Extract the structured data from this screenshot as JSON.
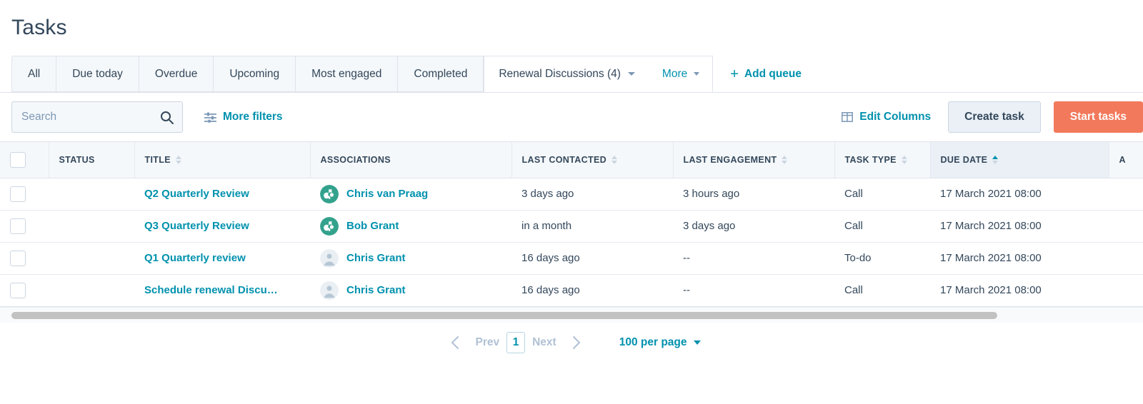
{
  "header": {
    "title": "Tasks"
  },
  "tabs": {
    "items": [
      {
        "label": "All",
        "active": false
      },
      {
        "label": "Due today",
        "active": false
      },
      {
        "label": "Overdue",
        "active": false
      },
      {
        "label": "Upcoming",
        "active": false
      },
      {
        "label": "Most engaged",
        "active": false
      },
      {
        "label": "Completed",
        "active": false
      },
      {
        "label": "Renewal Discussions (4)",
        "active": true
      }
    ],
    "more_label": "More",
    "add_queue_label": "Add queue",
    "add_queue_plus": "+"
  },
  "toolbar": {
    "search_placeholder": "Search",
    "search_value": "",
    "more_filters_label": "More filters",
    "edit_columns_label": "Edit Columns",
    "create_task_label": "Create task",
    "start_tasks_label": "Start tasks",
    "primary_color": "#f2795b",
    "link_color": "#0091ae"
  },
  "table": {
    "columns": [
      {
        "key": "status",
        "label": "STATUS",
        "sortable": false
      },
      {
        "key": "title",
        "label": "TITLE",
        "sortable": true,
        "sort": "none"
      },
      {
        "key": "associations",
        "label": "ASSOCIATIONS",
        "sortable": false
      },
      {
        "key": "last_contacted",
        "label": "LAST CONTACTED",
        "sortable": true,
        "sort": "none"
      },
      {
        "key": "last_engagement",
        "label": "LAST ENGAGEMENT",
        "sortable": true,
        "sort": "none"
      },
      {
        "key": "task_type",
        "label": "TASK TYPE",
        "sortable": true,
        "sort": "none"
      },
      {
        "key": "due_date",
        "label": "DUE DATE",
        "sortable": true,
        "sort": "asc"
      },
      {
        "key": "extra",
        "label": "A",
        "sortable": false
      }
    ],
    "rows": [
      {
        "status": "",
        "title": "Q2 Quarterly Review",
        "association": "Chris van Praag",
        "avatar": "company-logo-icon",
        "last_contacted": "3 days ago",
        "last_engagement": "3 hours ago",
        "task_type": "Call",
        "due_date": "17 March 2021 08:00"
      },
      {
        "status": "",
        "title": "Q3 Quarterly Review",
        "association": "Bob Grant",
        "avatar": "company-logo-icon",
        "last_contacted": "in a month",
        "last_engagement": "3 days ago",
        "task_type": "Call",
        "due_date": "17 March 2021 08:00"
      },
      {
        "status": "",
        "title": "Q1 Quarterly review",
        "association": "Chris Grant",
        "avatar": "person-icon",
        "last_contacted": "16 days ago",
        "last_engagement": "--",
        "task_type": "To-do",
        "due_date": "17 March 2021 08:00"
      },
      {
        "status": "",
        "title": "Schedule renewal Discu…",
        "association": "Chris Grant",
        "avatar": "person-icon",
        "last_contacted": "16 days ago",
        "last_engagement": "--",
        "task_type": "Call",
        "due_date": "17 March 2021 08:00"
      }
    ]
  },
  "pagination": {
    "prev_label": "Prev",
    "current_page": "1",
    "next_label": "Next",
    "per_page_label": "100 per page"
  }
}
